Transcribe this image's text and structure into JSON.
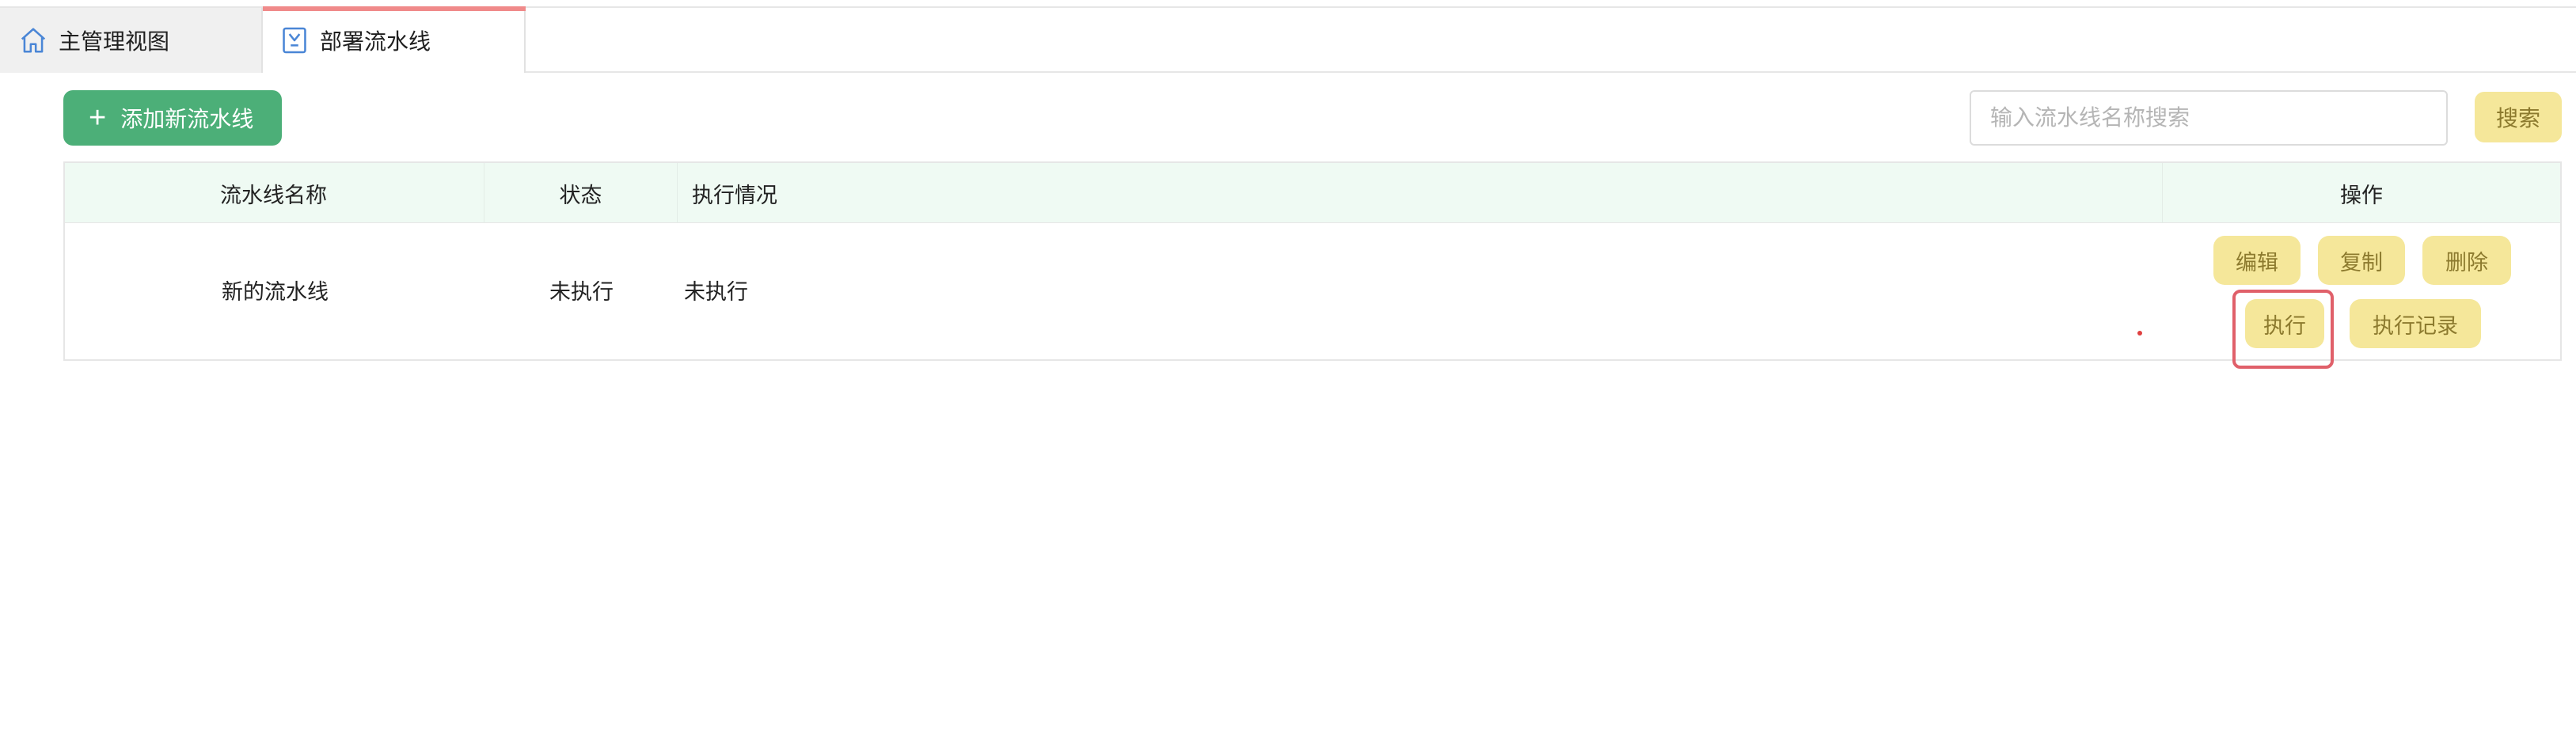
{
  "tabs": [
    {
      "label": "主管理视图",
      "icon": "home-icon",
      "active": false
    },
    {
      "label": "部署流水线",
      "icon": "pipeline-doc-icon",
      "active": true
    }
  ],
  "toolbar": {
    "add_label": "添加新流水线",
    "search_placeholder": "输入流水线名称搜索",
    "search_value": "",
    "search_label": "搜索"
  },
  "table": {
    "headers": [
      "流水线名称",
      "状态",
      "执行情况",
      "操作"
    ],
    "rows": [
      {
        "name": "新的流水线",
        "status": "未执行",
        "execution": "未执行",
        "actions": [
          "编辑",
          "复制",
          "删除",
          "执行",
          "执行记录"
        ]
      }
    ]
  },
  "colors": {
    "accent_green": "#4caf78",
    "action_yellow": "#f5e79a",
    "header_bg": "#effaf3",
    "highlight_red": "#e0606a",
    "active_tab_bar": "#f08a8a"
  }
}
